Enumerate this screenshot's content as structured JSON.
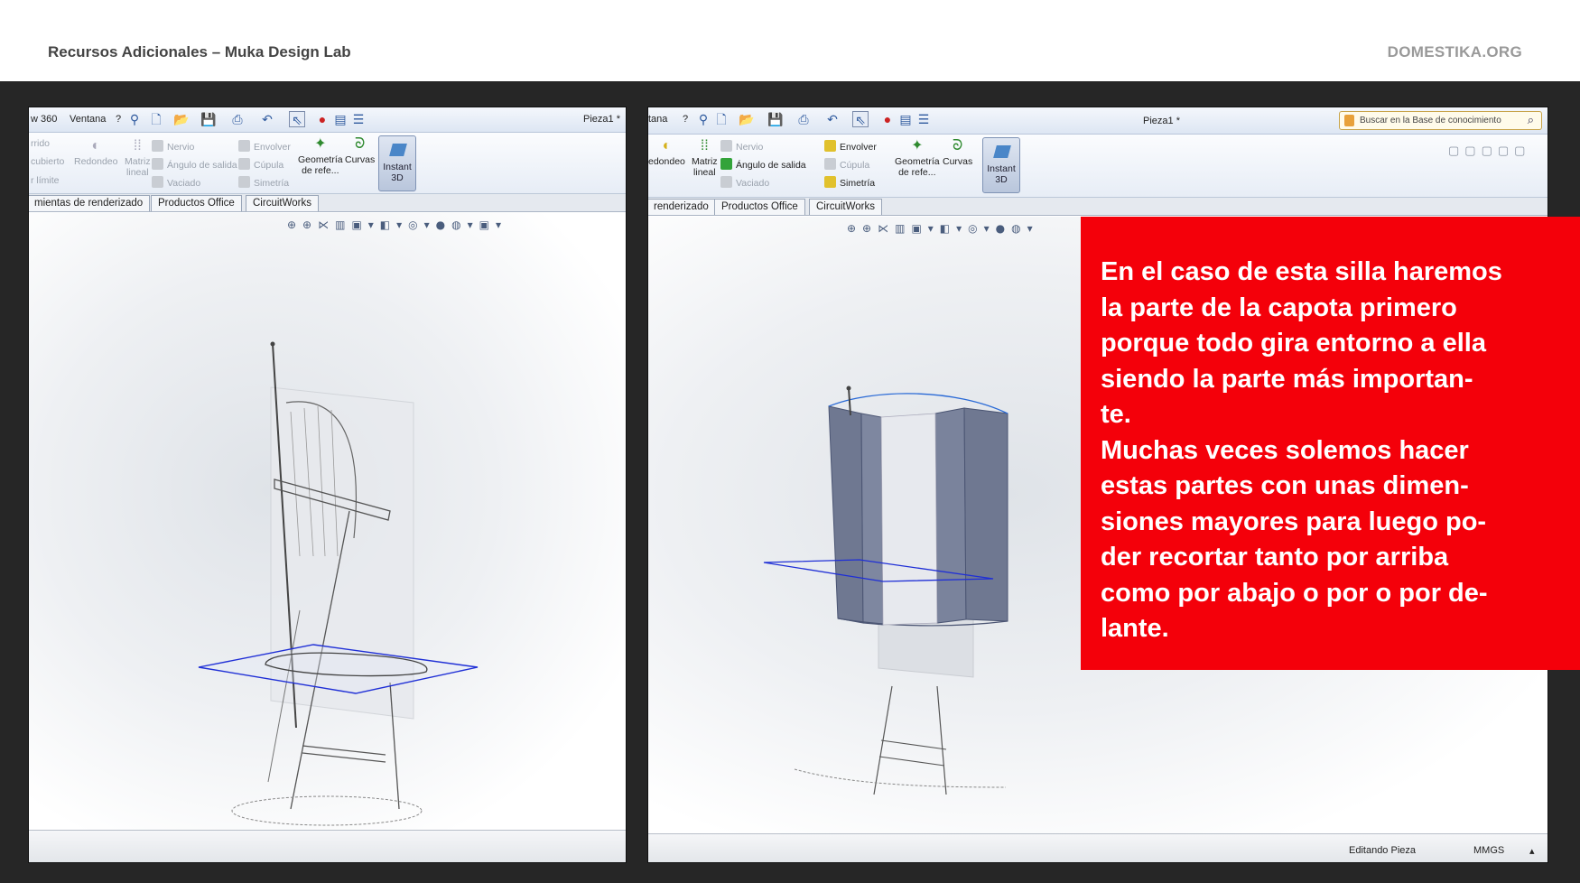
{
  "header": {
    "course_title": "Recursos Adicionales – Muka Design Lab",
    "brand": "DOMESTIKA.ORG"
  },
  "left_window": {
    "menu": {
      "item_a": "w 360",
      "item_b": "Ventana",
      "item_c": "?",
      "doc_title": "Pieza1 *"
    },
    "ribbon": {
      "barrido": "rrido",
      "recubierto": "cubierto",
      "limite": "r límite",
      "redondeo": "Redondeo",
      "matriz": "Matriz",
      "lineal": "lineal",
      "nervio": "Nervio",
      "angulo": "Ángulo de salida",
      "vaciado": "Vaciado",
      "envolver": "Envolver",
      "cupula": "Cúpula",
      "simetria": "Simetría",
      "geometria": "Geometría",
      "de_refe": "de refe...",
      "curvas": "Curvas",
      "instant": "Instant",
      "three_d": "3D"
    },
    "tabs": [
      "mientas de renderizado",
      "Productos Office",
      "CircuitWorks"
    ]
  },
  "right_window": {
    "menu": {
      "item_a": "tana",
      "item_c": "?",
      "doc_title": "Pieza1 *",
      "search_placeholder": "Buscar en la Base de conocimiento"
    },
    "ribbon": {
      "redondeo": "edondeo",
      "matriz": "Matriz",
      "lineal": "lineal",
      "nervio": "Nervio",
      "angulo": "Ángulo de salida",
      "vaciado": "Vaciado",
      "envolver": "Envolver",
      "cupula": "Cúpula",
      "simetria": "Simetría",
      "geometria": "Geometría",
      "de_refe": "de refe...",
      "curvas": "Curvas",
      "instant": "Instant",
      "three_d": "3D"
    },
    "tabs": [
      "renderizado",
      "Productos Office",
      "CircuitWorks"
    ],
    "status": {
      "mode": "Editando Pieza",
      "units": "MMGS"
    }
  },
  "callout": {
    "text": "En el caso de esta silla haremos\nla parte de la capota primero\nporque todo gira entorno a ella\nsiendo la parte más importan-\nte.\nMuchas veces solemos hacer\nestas partes con unas dimen-\nsiones mayores para luego po-\nder recortar tanto por arriba\ncomo por abajo o por o por de-\nlante."
  },
  "colors": {
    "callout_bg": "#f4000a",
    "stage_bg": "#262626",
    "sketch_plane": "#1f2fd6",
    "surface": "#6f7891"
  },
  "icons": [
    "new-doc-icon",
    "open-folder-icon",
    "save-icon",
    "print-icon",
    "undo-icon",
    "select-arrow-icon",
    "traffic-light-icon",
    "options-icon",
    "zoom-fit-icon",
    "zoom-area-icon",
    "section-view-icon",
    "view-orientation-icon",
    "display-style-icon",
    "appearance-icon",
    "scene-icon",
    "search-icon"
  ]
}
